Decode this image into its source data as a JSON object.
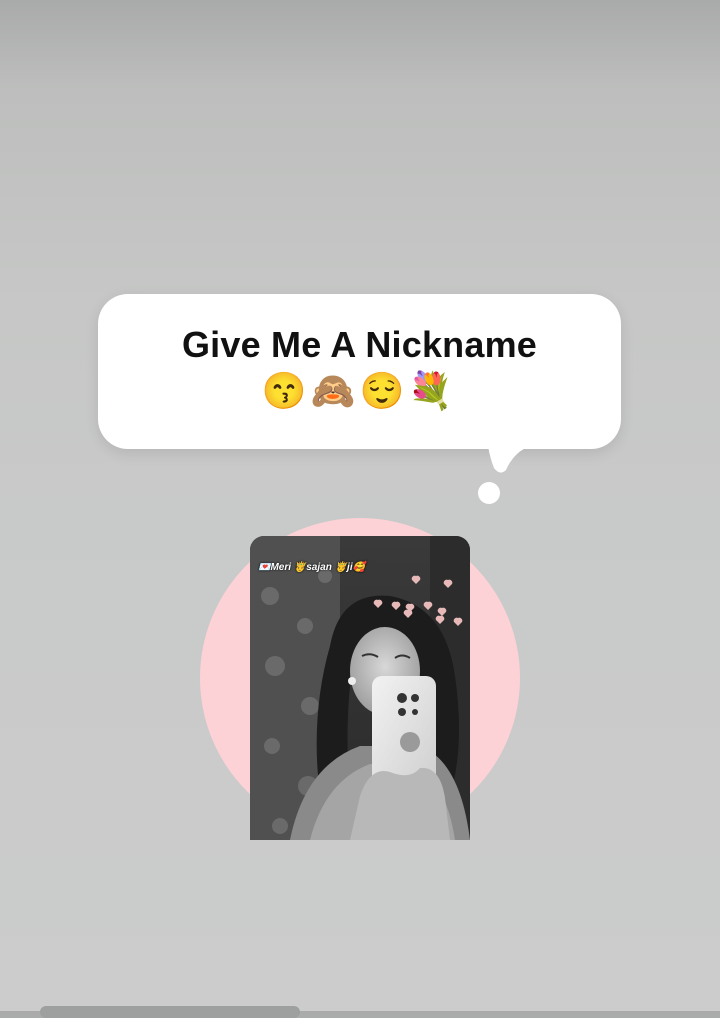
{
  "bubble": {
    "title": "Give Me A Nickname",
    "emojis": "😙🙈😌💐"
  },
  "avatar": {
    "ring_color": "#fcd2d6",
    "photo_caption": "💌Meri 🤴sajan 🤴ji🥰"
  },
  "colors": {
    "background": "#c9caca",
    "bubble": "#ffffff",
    "title_text": "#111111"
  }
}
